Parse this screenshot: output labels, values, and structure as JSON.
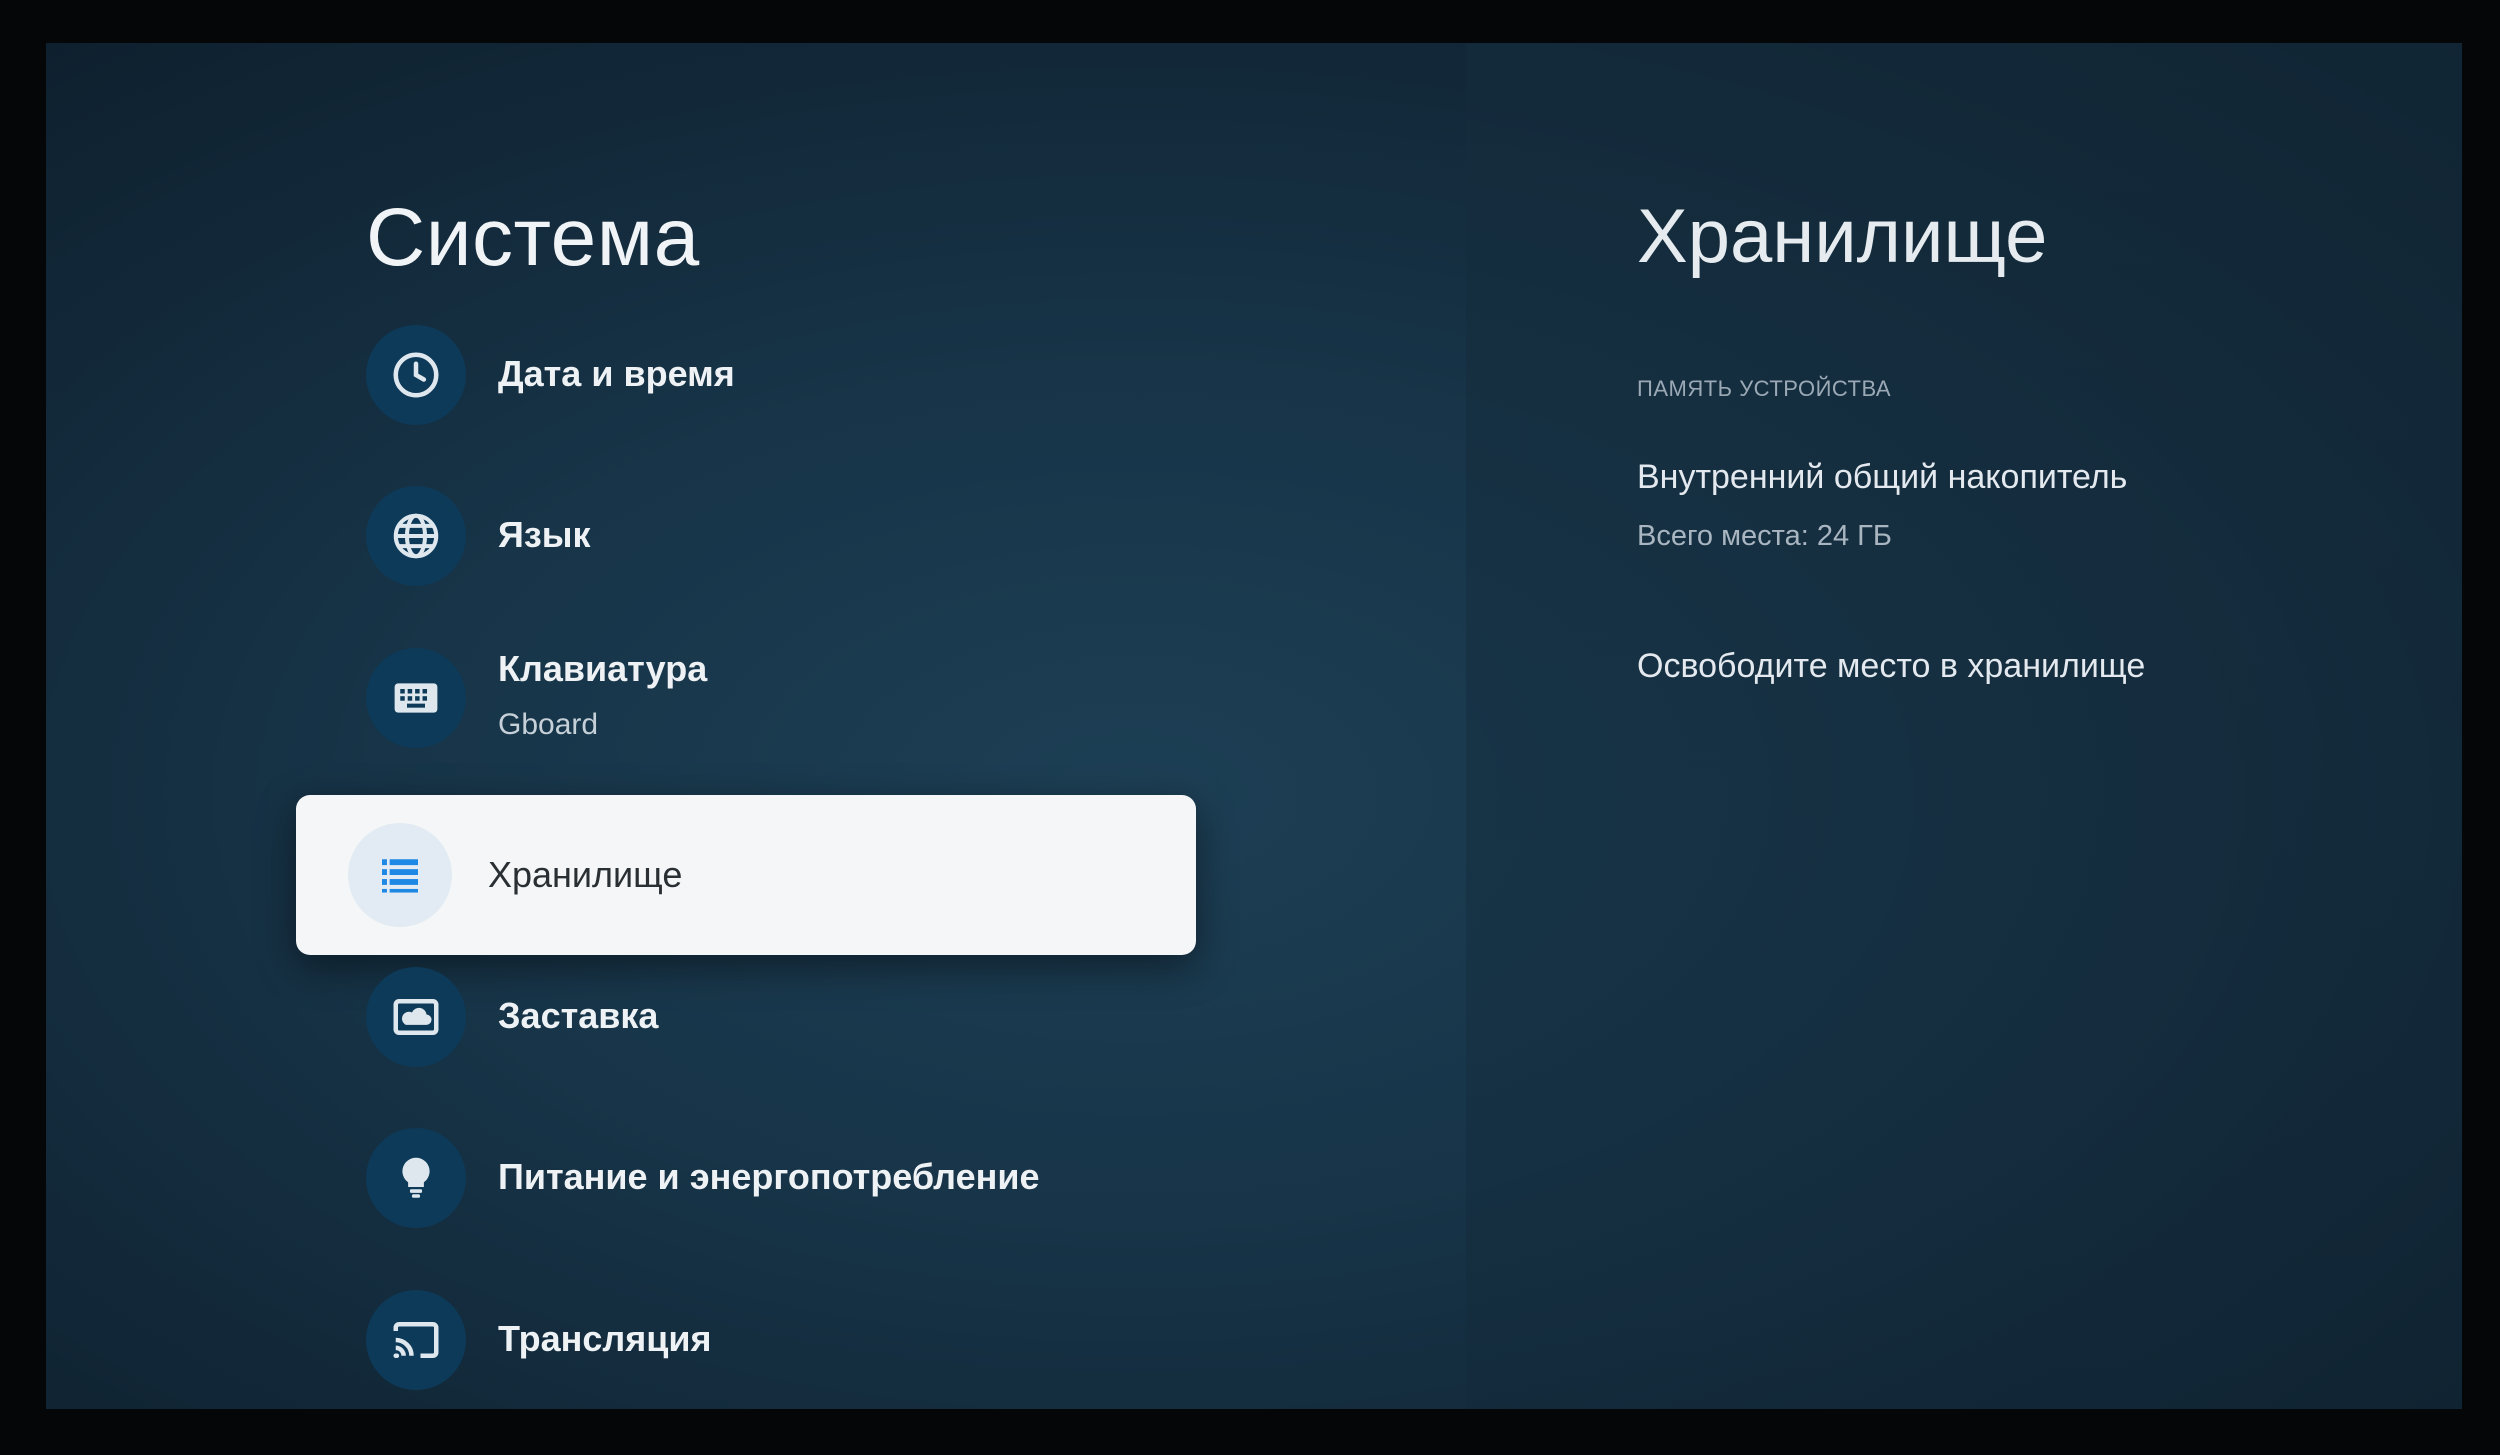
{
  "system": {
    "title": "Система",
    "items": [
      {
        "label": "Дата и время",
        "sub": "",
        "icon": "clock-icon"
      },
      {
        "label": "Язык",
        "sub": "",
        "icon": "globe-icon"
      },
      {
        "label": "Клавиатура",
        "sub": "Gboard",
        "icon": "keyboard-icon"
      },
      {
        "label": "Хранилище",
        "sub": "",
        "icon": "storage-list-icon",
        "selected": true
      },
      {
        "label": "Заставка",
        "sub": "",
        "icon": "screensaver-icon"
      },
      {
        "label": "Питание и энергопотребление",
        "sub": "",
        "icon": "lightbulb-icon"
      },
      {
        "label": "Трансляция",
        "sub": "",
        "icon": "cast-icon"
      }
    ]
  },
  "storage": {
    "title": "Хранилище",
    "section_header": "ПАМЯТЬ УСТРОЙСТВА",
    "device_name": "Внутренний общий накопитель",
    "total": "Всего места: 24 ГБ",
    "free_space_action": "Освободите место в хранилище"
  },
  "colors": {
    "background": "#173448",
    "icon_circle": "#0d3a58",
    "selected_card": "#f4f6f8",
    "selected_icon": "#1e88e5"
  }
}
